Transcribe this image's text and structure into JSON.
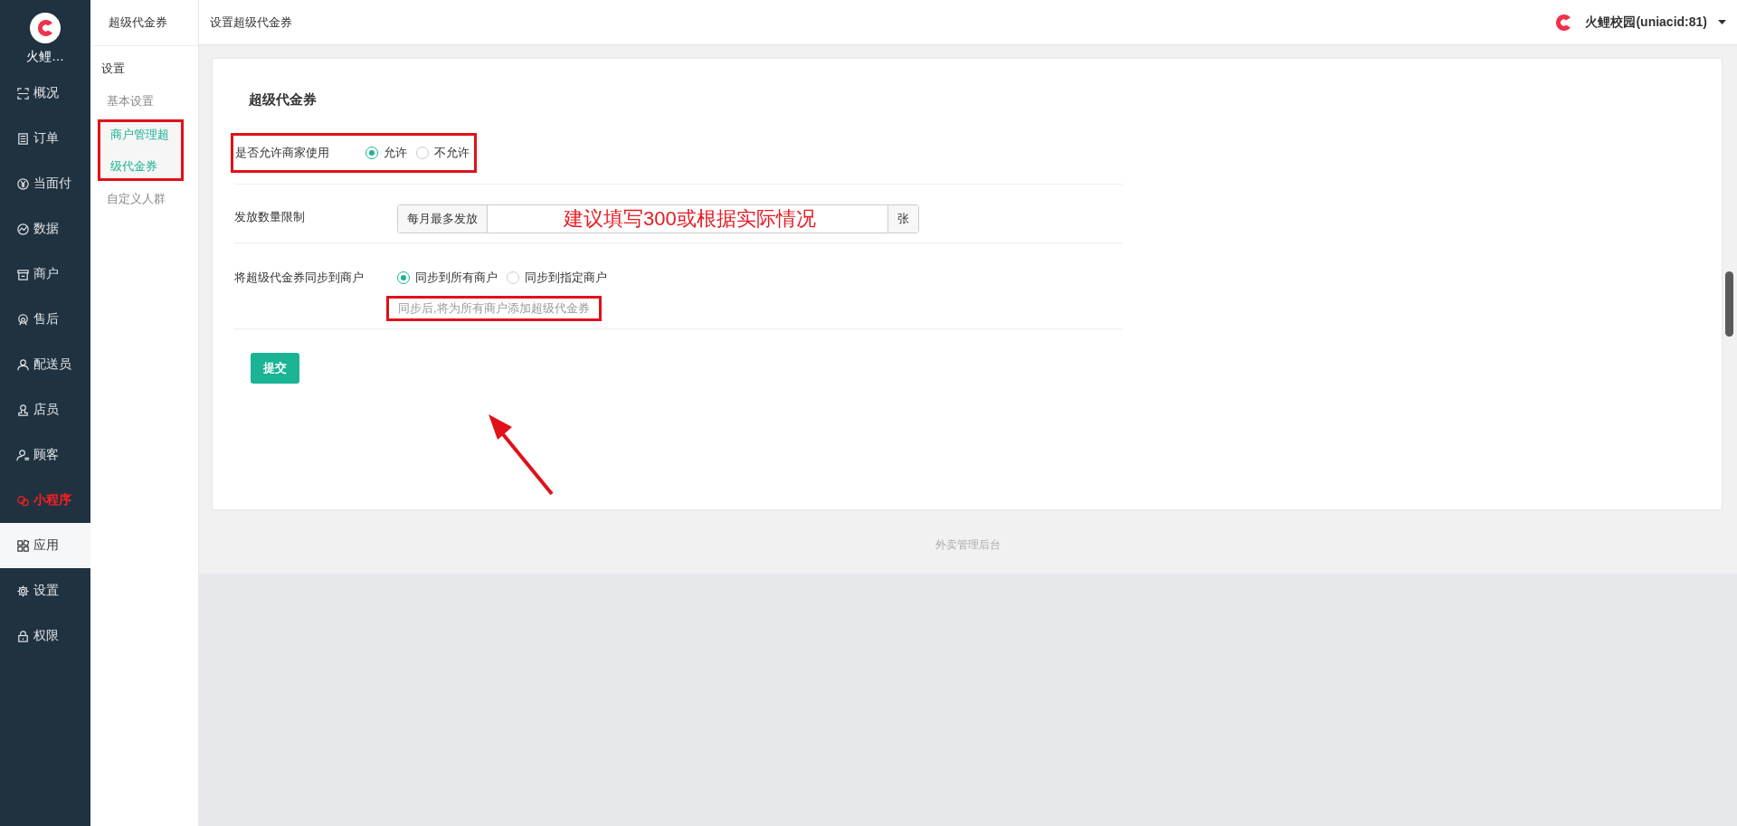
{
  "app": {
    "name": "火鲤…"
  },
  "nav": [
    {
      "label": "概况",
      "selected": false,
      "highlighted": false
    },
    {
      "label": "订单",
      "selected": false,
      "highlighted": false
    },
    {
      "label": "当面付",
      "selected": false,
      "highlighted": false
    },
    {
      "label": "数据",
      "selected": false,
      "highlighted": false
    },
    {
      "label": "商户",
      "selected": false,
      "highlighted": false
    },
    {
      "label": "售后",
      "selected": false,
      "highlighted": false
    },
    {
      "label": "配送员",
      "selected": false,
      "highlighted": false
    },
    {
      "label": "店员",
      "selected": false,
      "highlighted": false
    },
    {
      "label": "顾客",
      "selected": false,
      "highlighted": false
    },
    {
      "label": "小程序",
      "selected": false,
      "highlighted": true
    },
    {
      "label": "应用",
      "selected": true,
      "highlighted": false
    },
    {
      "label": "设置",
      "selected": false,
      "highlighted": false
    },
    {
      "label": "权限",
      "selected": false,
      "highlighted": false
    }
  ],
  "submenu": {
    "title": "超级代金券",
    "group": "设置",
    "items": [
      {
        "label": "基本设置",
        "selected": false
      },
      {
        "label": "商户管理超级代金券",
        "selected": true
      },
      {
        "label": "自定义人群",
        "selected": false
      }
    ]
  },
  "header": {
    "title": "设置超级代金券",
    "account": "火鲤校园(uniacid:81)"
  },
  "form": {
    "title": "超级代金券",
    "allow": {
      "label": "是否允许商家使用",
      "options": [
        {
          "label": "允许",
          "selected": true
        },
        {
          "label": "不允许",
          "selected": false
        }
      ]
    },
    "limit": {
      "label": "发放数量限制",
      "prefix": "每月最多发放",
      "suffix": "张",
      "note": "建议填写300或根据实际情况"
    },
    "sync": {
      "label": "将超级代金券同步到商户",
      "options": [
        {
          "label": "同步到所有商户",
          "selected": true
        },
        {
          "label": "同步到指定商户",
          "selected": false
        }
      ],
      "help": "同步后,将为所有商户添加超级代金券"
    },
    "submit": "提交"
  },
  "footer": "外卖管理后台"
}
